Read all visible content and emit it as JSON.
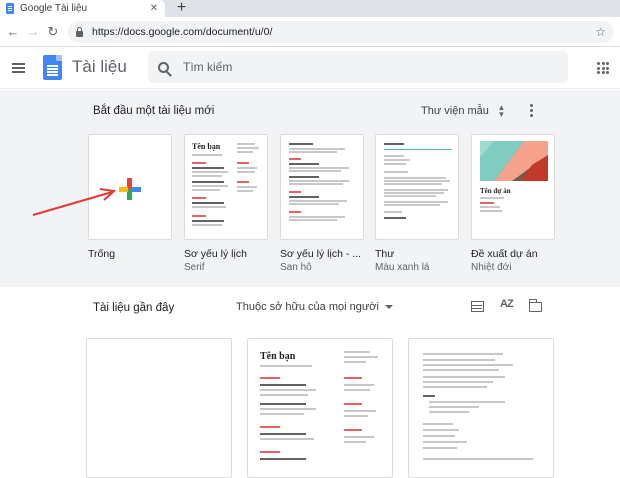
{
  "browser": {
    "tab_title": "Google Tài liệu",
    "tab_close": "✕",
    "new_tab": "+",
    "back": "←",
    "forward": "→",
    "reload": "↻",
    "url": "https://docs.google.com/document/u/0/",
    "bookmark": "☆"
  },
  "header": {
    "app_name": "Tài liệu",
    "search_placeholder": "Tìm kiếm"
  },
  "gallery": {
    "title": "Bắt đầu một tài liệu mới",
    "template_gallery_label": "Thư viện mẫu",
    "templates": [
      {
        "name": "Trống",
        "subtitle": ""
      },
      {
        "name": "Sơ yếu lý lịch",
        "subtitle": "Serif",
        "heading": "Tên bạn"
      },
      {
        "name": "Sơ yếu lý lịch - ...",
        "subtitle": "San hô"
      },
      {
        "name": "Thư",
        "subtitle": "Màu xanh lá"
      },
      {
        "name": "Đề xuất dự án",
        "subtitle": "Nhiệt đới",
        "heading": "Tên dự án"
      }
    ]
  },
  "recent": {
    "title": "Tài liệu gần đây",
    "owner_filter": "Thuộc sở hữu của mọi người",
    "sort_label": "AZ",
    "docs": [
      {
        "heading": ""
      },
      {
        "heading": "Tên bạn"
      },
      {
        "heading": ""
      }
    ]
  },
  "colors": {
    "accent_blue": "#4285f4",
    "gallery_bg": "#f1f3f4",
    "annotation_arrow": "#e53935"
  }
}
